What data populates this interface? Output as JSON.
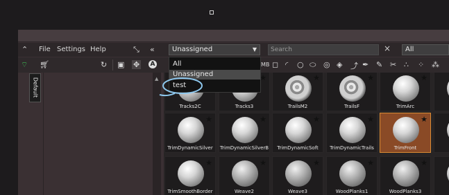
{
  "menus": [
    "File",
    "Settings",
    "Help"
  ],
  "collection_dropdown": {
    "value": "Unassigned",
    "options": [
      "All",
      "Unassigned",
      "test"
    ],
    "highlighted": "Unassigned"
  },
  "search": {
    "placeholder": "Search"
  },
  "filter_dropdown": {
    "value": "All"
  },
  "side_tab": "Default",
  "icons": {
    "collapse": "chevron-up-icon",
    "wifi": "wifi-icon",
    "cart": "cart-icon",
    "refresh": "refresh-icon",
    "layout": "layout-icon",
    "move": "move-icon",
    "letter": "A",
    "shrink": "shrink-icon",
    "collapse_left": "double-chevron-left-icon",
    "close": "×"
  },
  "brushes": {
    "row1": [
      {
        "name": "Tracks2C",
        "style": "plain"
      },
      {
        "name": "Tracks3",
        "style": "plain"
      },
      {
        "name": "TrailsM2",
        "style": "swirl"
      },
      {
        "name": "TrailsF",
        "style": "swirl"
      },
      {
        "name": "TrimArc",
        "style": "plain"
      },
      {
        "name": "Tr",
        "style": "plain"
      }
    ],
    "row2": [
      {
        "name": "TrimDynamicSilver",
        "style": "plain"
      },
      {
        "name": "TrimDynamicSilverB",
        "style": "plain"
      },
      {
        "name": "TrimDynamicSoft",
        "style": "plain"
      },
      {
        "name": "TrimDynamicTrails",
        "style": "plain"
      },
      {
        "name": "TrimFront",
        "style": "plain",
        "selected": true
      },
      {
        "name": "",
        "style": "plain"
      }
    ],
    "row3": [
      {
        "name": "TrimSmoothBorder",
        "style": "plain"
      },
      {
        "name": "Weave2",
        "style": "rough"
      },
      {
        "name": "Weave3",
        "style": "rough"
      },
      {
        "name": "WoodPlanks1",
        "style": "rough"
      },
      {
        "name": "WoodPlanks3",
        "style": "rough"
      },
      {
        "name": "B",
        "style": "plain"
      }
    ]
  }
}
